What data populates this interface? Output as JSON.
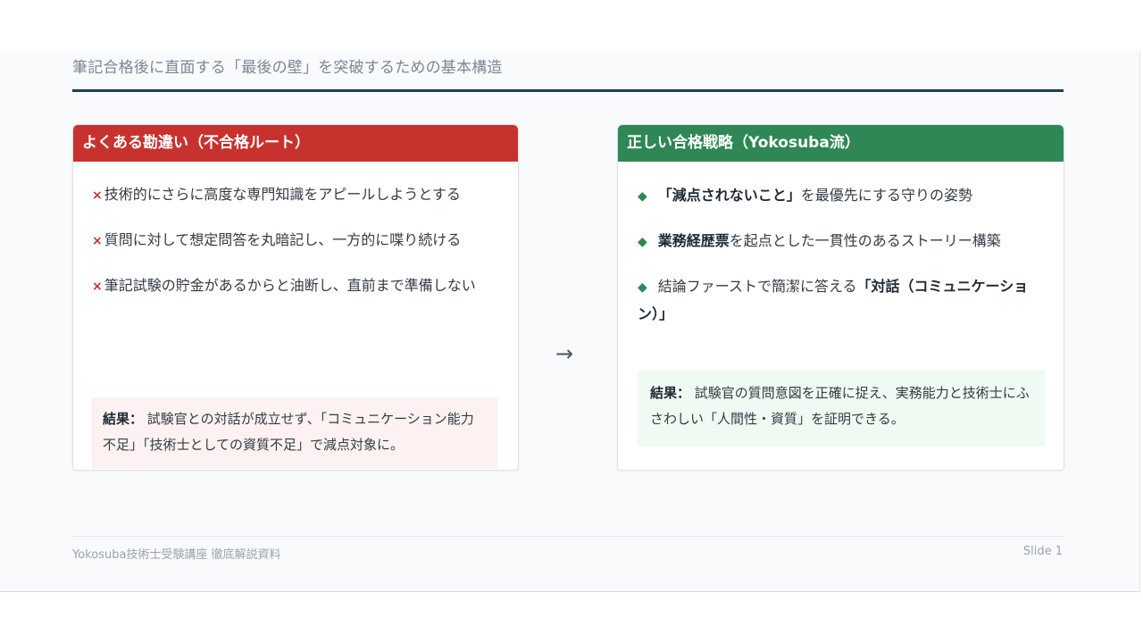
{
  "subtitle": "筆記合格後に直面する「最後の壁」を突破するための基本構造",
  "colors": {
    "title_rule": "#1f3b5c",
    "wrong_header": "#c7322f",
    "right_header": "#2e8754",
    "wrong_result_bg": "#fdf2f1",
    "right_result_bg": "#effbf2"
  },
  "left_card": {
    "title": "よくある勘違い（不合格ルート）",
    "marker": "×",
    "items": [
      {
        "text": "技術的にさらに高度な専門知識をアピールしようとする"
      },
      {
        "text": "質問に対して想定問答を丸暗記し、一方的に喋り続ける"
      },
      {
        "text": "筆記試験の貯金があるからと油断し、直前まで準備しない"
      }
    ],
    "result_label": "結果：",
    "result_text": "試験官との対話が成立せず、「コミュニケーション能力不足」「技術士としての資質不足」で減点対象に。"
  },
  "arrow": "→",
  "right_card": {
    "title": "正しい合格戦略（Yokosuba流）",
    "marker": "◆",
    "items": [
      {
        "bold": "「減点されないこと」",
        "text": "を最優先にする守りの姿勢"
      },
      {
        "bold": "業務経歴票",
        "text": "を起点とした一貫性のあるストーリー構築"
      },
      {
        "text": "結論ファーストで簡潔に答える",
        "bold": "「対話（コミュニケーション）」"
      }
    ],
    "result_label": "結果：",
    "result_text": "試験官の質問意図を正確に捉え、実務能力と技術士にふさわしい「人間性・資質」を証明できる。"
  },
  "footer": {
    "left": "Yokosuba技術士受験講座 徹底解説資料",
    "right": "Slide 1"
  }
}
